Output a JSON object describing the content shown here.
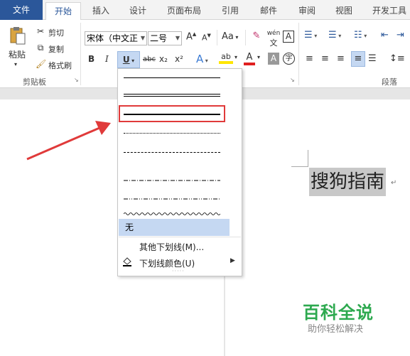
{
  "tabs": [
    "文件",
    "开始",
    "插入",
    "设计",
    "页面布局",
    "引用",
    "邮件",
    "审阅",
    "视图",
    "开发工具"
  ],
  "clipboard": {
    "paste": "粘贴",
    "cut": "剪切",
    "copy": "复制",
    "format_painter": "格式刷",
    "group_label": "剪贴板"
  },
  "font": {
    "name": "宋体（中文正",
    "size": "二号",
    "grow": "A",
    "shrink": "A",
    "case": "Aa",
    "clear": "A",
    "pinyin": "wén",
    "border": "A",
    "bold": "B",
    "italic": "I",
    "underline": "U",
    "strike": "abc",
    "sub": "x₂",
    "sup": "x²",
    "effect": "A",
    "highlight": "ab",
    "color": "A",
    "shading": "A",
    "circle": "字"
  },
  "paragraph": {
    "group_label": "段落"
  },
  "underline_menu": {
    "none": "无",
    "more": "其他下划线(M)...",
    "color": "下划线颜色(U)"
  },
  "document": {
    "text": "搜狗指南",
    "para_mark": "↵"
  },
  "watermark": {
    "title": "百科全说",
    "subtitle": "助你轻松解决"
  },
  "colors": {
    "file_tab": "#2b579a",
    "highlight_red": "#e03a3a",
    "selected_option": "#c5d8f2",
    "watermark_green": "#2da94f"
  }
}
